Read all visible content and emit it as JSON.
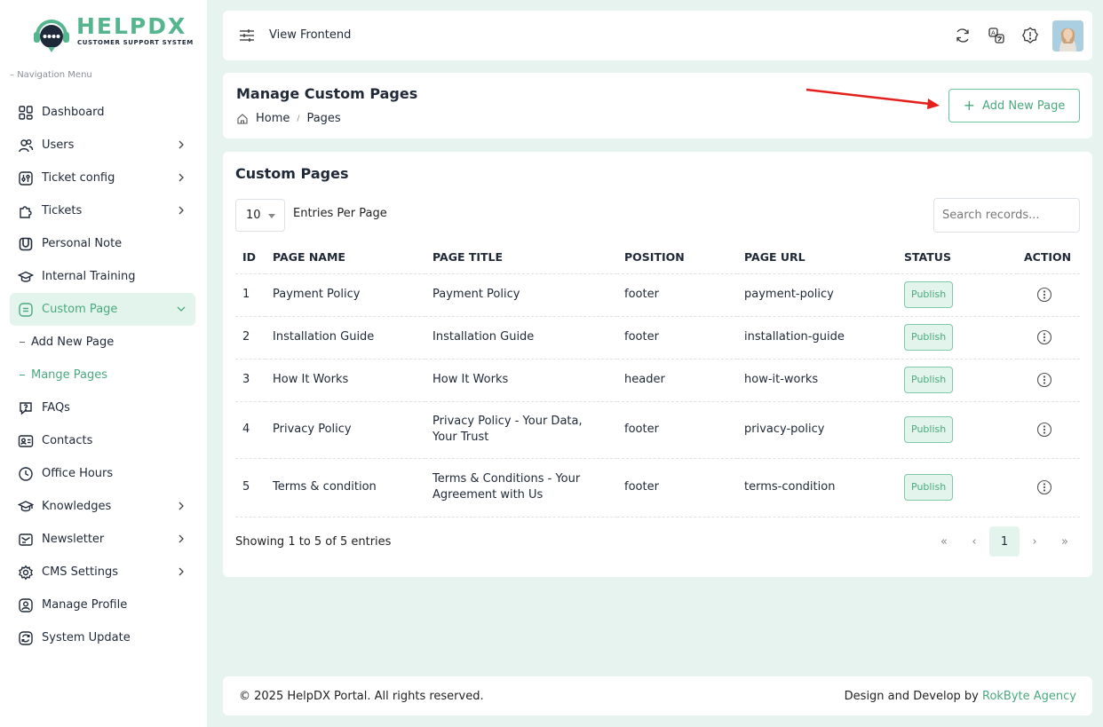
{
  "brand": {
    "name": "HELPDX",
    "tagline": "CUSTOMER SUPPORT SYSTEM"
  },
  "sidebar": {
    "heading": "Navigation Menu",
    "items": [
      {
        "label": "Dashboard",
        "icon": "grid-icon",
        "chevron": false
      },
      {
        "label": "Users",
        "icon": "users-icon",
        "chevron": true
      },
      {
        "label": "Ticket config",
        "icon": "ticket-config-icon",
        "chevron": true
      },
      {
        "label": "Tickets",
        "icon": "puzzle-icon",
        "chevron": true
      },
      {
        "label": "Personal Note",
        "icon": "note-icon",
        "chevron": false
      },
      {
        "label": "Internal Training",
        "icon": "graduation-cap-icon",
        "chevron": false
      },
      {
        "label": "Custom Page",
        "icon": "page-icon",
        "chevron": true,
        "active": true
      },
      {
        "label": "FAQs",
        "icon": "faq-icon",
        "chevron": false
      },
      {
        "label": "Contacts",
        "icon": "contact-card-icon",
        "chevron": false
      },
      {
        "label": "Office Hours",
        "icon": "clock-icon",
        "chevron": false
      },
      {
        "label": "Knowledges",
        "icon": "knowledge-icon",
        "chevron": true
      },
      {
        "label": "Newsletter",
        "icon": "newsletter-icon",
        "chevron": true
      },
      {
        "label": "CMS Settings",
        "icon": "gear-icon",
        "chevron": true
      },
      {
        "label": "Manage Profile",
        "icon": "profile-icon",
        "chevron": false
      },
      {
        "label": "System Update",
        "icon": "refresh-icon",
        "chevron": false
      }
    ],
    "subitems": [
      {
        "label": "Add New Page",
        "active": false
      },
      {
        "label": "Mange Pages",
        "active": true
      }
    ]
  },
  "header": {
    "view_frontend": "View Frontend",
    "icons": [
      "sync-icon",
      "translate-icon",
      "alert-icon"
    ]
  },
  "page_header": {
    "title": "Manage Custom Pages",
    "breadcrumb": {
      "home": "Home",
      "separator": "/",
      "current": "Pages"
    },
    "add_button": "Add New Page"
  },
  "main": {
    "title": "Custom Pages",
    "per_page_value": "10",
    "per_page_label": "Entries Per Page",
    "search_placeholder": "Search records...",
    "columns": [
      "ID",
      "PAGE NAME",
      "PAGE TITLE",
      "POSITION",
      "PAGE URL",
      "STATUS",
      "ACTION"
    ],
    "rows": [
      {
        "id": "1",
        "name": "Payment Policy",
        "title": "Payment Policy",
        "position": "footer",
        "url": "payment-policy",
        "status": "Publish"
      },
      {
        "id": "2",
        "name": "Installation Guide",
        "title": "Installation Guide",
        "position": "footer",
        "url": "installation-guide",
        "status": "Publish"
      },
      {
        "id": "3",
        "name": "How It Works",
        "title": "How It Works",
        "position": "header",
        "url": "how-it-works",
        "status": "Publish"
      },
      {
        "id": "4",
        "name": "Privacy Policy",
        "title": "Privacy Policy - Your Data, Your Trust",
        "position": "footer",
        "url": "privacy-policy",
        "status": "Publish"
      },
      {
        "id": "5",
        "name": "Terms & condition",
        "title": "Terms & Conditions - Your Agreement with Us",
        "position": "footer",
        "url": "terms-condition",
        "status": "Publish"
      }
    ],
    "showing": "Showing 1 to 5 of 5 entries",
    "pager": {
      "first": "«",
      "prev": "‹",
      "current": "1",
      "next": "›",
      "last": "»"
    }
  },
  "footer": {
    "copyright": "© 2025 HelpDX Portal. All rights reserved.",
    "design_prefix": "Design and Develop by ",
    "agency": "RokByte Agency"
  },
  "colors": {
    "accent": "#4aa97f",
    "background": "#e6f3ee",
    "arrow": "#e3201b"
  }
}
